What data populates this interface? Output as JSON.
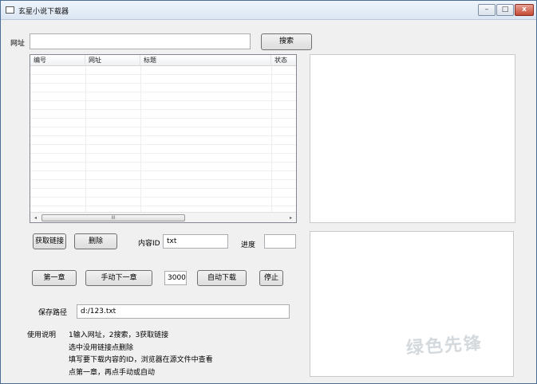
{
  "window": {
    "title": "玄星小说下载器",
    "controls": {
      "minimize": "–",
      "maximize": "□",
      "close": "x"
    }
  },
  "url_row": {
    "label": "网址",
    "value": "",
    "search_button": "搜索"
  },
  "table": {
    "columns": [
      "编号",
      "网址",
      "标题",
      "状态"
    ],
    "rows": [],
    "scroll_left": "◂",
    "scroll_grip": "III",
    "scroll_right": "▸"
  },
  "actions": {
    "get_links": "获取链接",
    "delete": "删除",
    "content_id_label": "内容ID",
    "content_id_value": "txt",
    "progress_label": "进度",
    "progress_value": ""
  },
  "chapter_row": {
    "first_chapter": "第一章",
    "manual_next": "手动下一章",
    "interval_value": "3000",
    "auto_download": "自动下载",
    "stop": "停止"
  },
  "save": {
    "label": "保存路径",
    "path": "d:/123.txt"
  },
  "instructions": {
    "label": "使用说明",
    "lines": [
      "1输入网址，2搜索，3获取链接",
      "选中没用链接点删除",
      "填写要下载内容的ID，浏览器在源文件中查看",
      "点第一章，再点手动或自动"
    ]
  },
  "watermark": "绿色先锋"
}
